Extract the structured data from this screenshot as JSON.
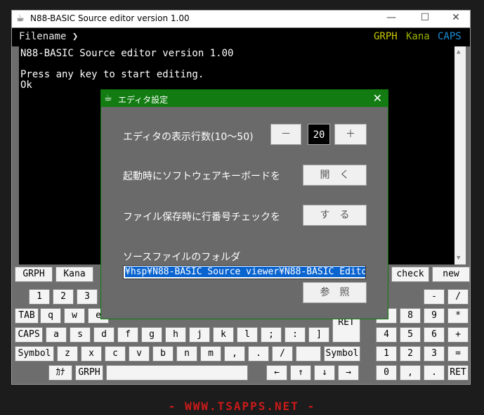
{
  "window": {
    "title": "N88-BASIC Source editor version 1.00",
    "icon": "app-icon"
  },
  "topbar": {
    "filename_label": "Filename ❯",
    "indicators": [
      {
        "label": "GRPH",
        "color": "#c8c800"
      },
      {
        "label": "Kana",
        "color": "#9ab000"
      },
      {
        "label": "CAPS",
        "color": "#1a8fd8"
      }
    ]
  },
  "screen": {
    "text": "N88-BASIC Source editor version 1.00\n\nPress any key to start editing.\nOk"
  },
  "fkeys": [
    "GRPH",
    "Kana",
    "check",
    "new"
  ],
  "keyboard": {
    "row1": [
      "1",
      "2",
      "3"
    ],
    "row2": [
      "TAB",
      "q",
      "w",
      "e"
    ],
    "row3": [
      "CAPS",
      "a",
      "s",
      "d",
      "f",
      "g",
      "h",
      "j",
      "k",
      "l",
      ";",
      ":",
      "]"
    ],
    "row4": [
      "Symbol",
      "z",
      "x",
      "c",
      "v",
      "b",
      "n",
      "m",
      ",",
      ".",
      "/",
      "",
      "Symbol"
    ],
    "row5": [
      "ｶﾅ",
      "GRPH",
      "",
      "←",
      "↑",
      "↓",
      "→"
    ],
    "ret": "RET",
    "numpad": [
      [
        "-",
        "/"
      ],
      [
        "7",
        "8",
        "9",
        "*"
      ],
      [
        "4",
        "5",
        "6",
        "+"
      ],
      [
        "1",
        "2",
        "3",
        "="
      ],
      [
        "0",
        ",",
        ".",
        "RET"
      ]
    ]
  },
  "dialog": {
    "title": "エディタ設定",
    "rows_label": "エディタの表示行数(10～50)",
    "minus": "－",
    "rows_value": "20",
    "plus": "＋",
    "keyboard_label": "起動時にソフトウェアキーボードを",
    "keyboard_button": "開　く",
    "linecheck_label": "ファイル保存時に行番号チェックを",
    "linecheck_button": "す　る",
    "folder_label": "ソースファイルのフォルダ",
    "folder_value": "¥hsp¥N88-BASIC Source viewer¥N88-BASIC Editor",
    "browse_button": "参　照"
  },
  "footer": {
    "text": "- WWW.TSAPPS.NET -"
  }
}
